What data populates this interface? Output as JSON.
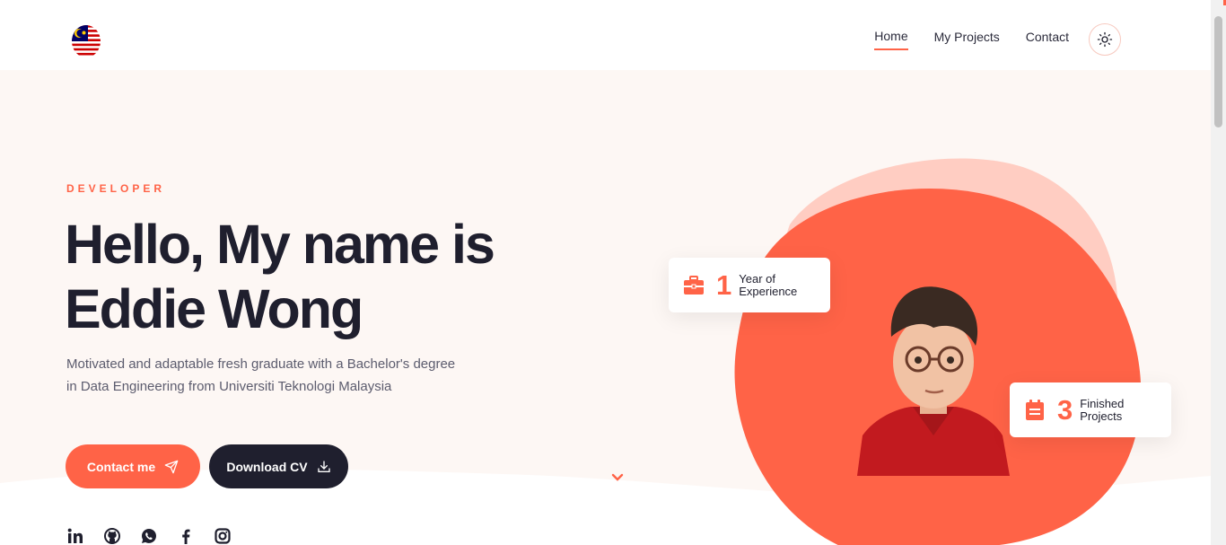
{
  "header": {
    "logo_alt": "Malaysia flag",
    "nav": [
      {
        "label": "Home",
        "active": true
      },
      {
        "label": "My Projects",
        "active": false
      },
      {
        "label": "Contact",
        "active": false
      }
    ],
    "theme_toggle_icon": "sun-icon"
  },
  "hero": {
    "eyebrow": "DEVELOPER",
    "title_line1": "Hello, My name is",
    "title_line2": "Eddie Wong",
    "description": "Motivated and adaptable fresh graduate with a Bachelor's degree in Data Engineering from Universiti Teknologi Malaysia",
    "contact_button": "Contact me",
    "cv_button": "Download CV",
    "scroll_icon": "chevron-down-icon"
  },
  "stats": [
    {
      "number": "1",
      "label": "Year of Experience",
      "icon": "briefcase-icon"
    },
    {
      "number": "3",
      "label": "Finished Projects",
      "icon": "clipboard-icon"
    }
  ],
  "socials": [
    "linkedin-icon",
    "github-icon",
    "whatsapp-icon",
    "facebook-icon",
    "instagram-icon"
  ],
  "colors": {
    "accent": "#ff6347",
    "accent_light": "#ffcdc2",
    "dark": "#1f1f2e",
    "background": "#fdf7f4"
  }
}
